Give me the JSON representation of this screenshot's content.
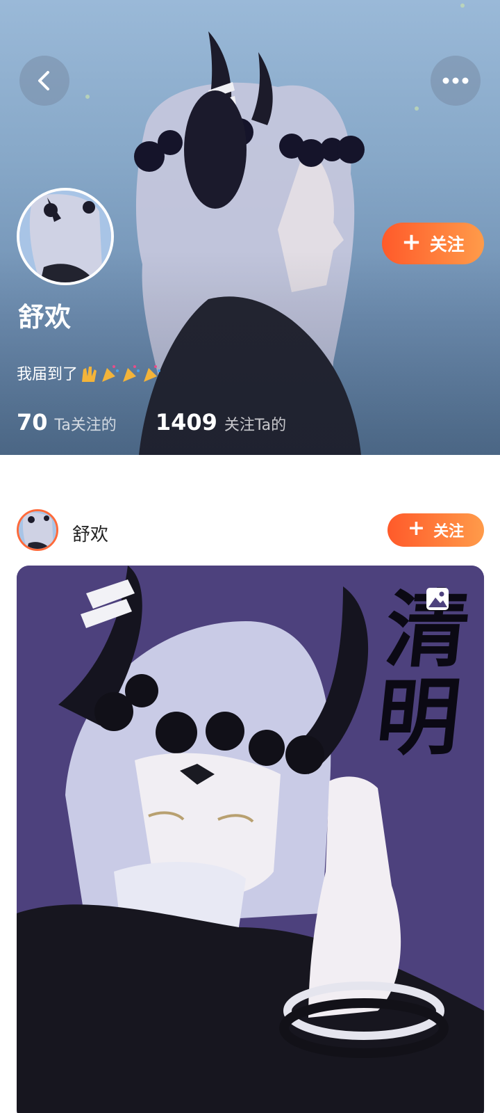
{
  "header": {
    "back_icon": "chevron-left-icon",
    "more_icon": "more-dots-icon",
    "follow_label": "关注",
    "username": "舒欢",
    "bio": "我届到了",
    "stats": {
      "following_count": "70",
      "following_label": "Ta关注的",
      "followers_count": "1409",
      "followers_label": "关注Ta的"
    }
  },
  "post": {
    "author": "舒欢",
    "follow_label": "关注",
    "image_badge_icon": "image-icon",
    "image_text": [
      "清",
      "明"
    ]
  },
  "colors": {
    "accent_start": "#ff5a2a",
    "accent_end": "#ff9b4a",
    "header_bg": "#87a8c8",
    "post_bg": "#4a3f7a"
  }
}
